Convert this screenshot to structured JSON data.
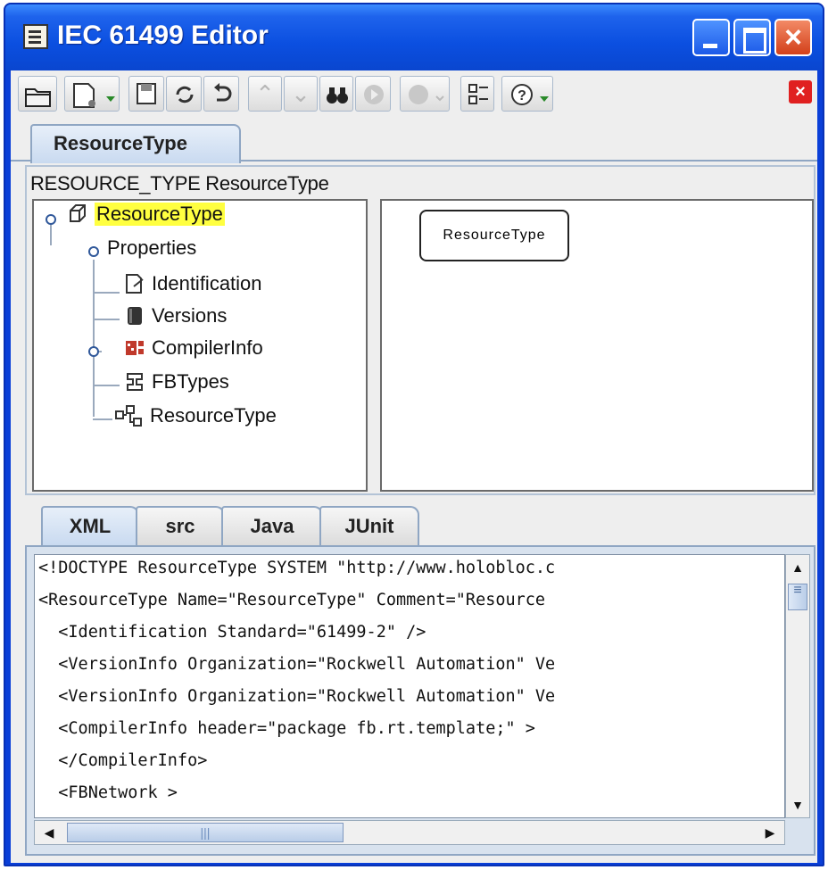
{
  "window": {
    "title": "IEC 61499 Editor"
  },
  "main_tab": {
    "label": "ResourceType"
  },
  "resource_panel": {
    "header": "RESOURCE_TYPE ResourceType",
    "tree": {
      "root": "ResourceType",
      "properties": "Properties",
      "identification": "Identification",
      "versions": "Versions",
      "compiler_info": "CompilerInfo",
      "fb_types": "FBTypes",
      "resource_type": "ResourceType"
    },
    "diagram_block": "ResourceType"
  },
  "lower_tabs": [
    "XML",
    "src",
    "Java",
    "JUnit"
  ],
  "code_lines": [
    "<!DOCTYPE ResourceType SYSTEM \"http://www.holobloc.c",
    "<ResourceType Name=\"ResourceType\" Comment=\"Resource",
    "  <Identification Standard=\"61499-2\" />",
    "  <VersionInfo Organization=\"Rockwell Automation\" Ve",
    "  <VersionInfo Organization=\"Rockwell Automation\" Ve",
    "  <CompilerInfo header=\"package fb.rt.template;\" >",
    "  </CompilerInfo>",
    "  <FBNetwork >"
  ],
  "icons": {
    "toolbar": [
      "open-folder-icon",
      "new-document-icon",
      "save-icon",
      "refresh-icon",
      "undo-icon",
      "up-arrow-icon",
      "down-arrow-icon",
      "find-icon",
      "run-icon",
      "record-icon",
      "properties-icon",
      "help-icon",
      "close-editor-icon"
    ]
  },
  "colors": {
    "title_bar": "#0b4fe0",
    "highlight": "#ffff40",
    "close_button": "#d2401a"
  }
}
